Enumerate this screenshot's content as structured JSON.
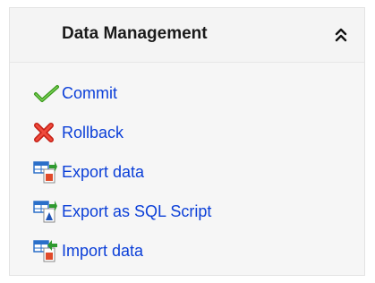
{
  "panel": {
    "title": "Data Management",
    "collapse_icon": "double-chevron-up-icon"
  },
  "items": [
    {
      "label": "Commit",
      "icon": "checkmark-icon",
      "icon_color": "#3a9a1c"
    },
    {
      "label": "Rollback",
      "icon": "red-x-icon",
      "icon_color": "#d8261c"
    },
    {
      "label": "Export data",
      "icon": "export-data-icon",
      "icon_color": "#2a6fc9"
    },
    {
      "label": "Export as SQL Script",
      "icon": "export-sql-icon",
      "icon_color": "#2a6fc9"
    },
    {
      "label": "Import data",
      "icon": "import-data-icon",
      "icon_color": "#2a6fc9"
    }
  ],
  "colors": {
    "link": "#0b3fd8",
    "panel_bg": "#f6f6f6"
  }
}
